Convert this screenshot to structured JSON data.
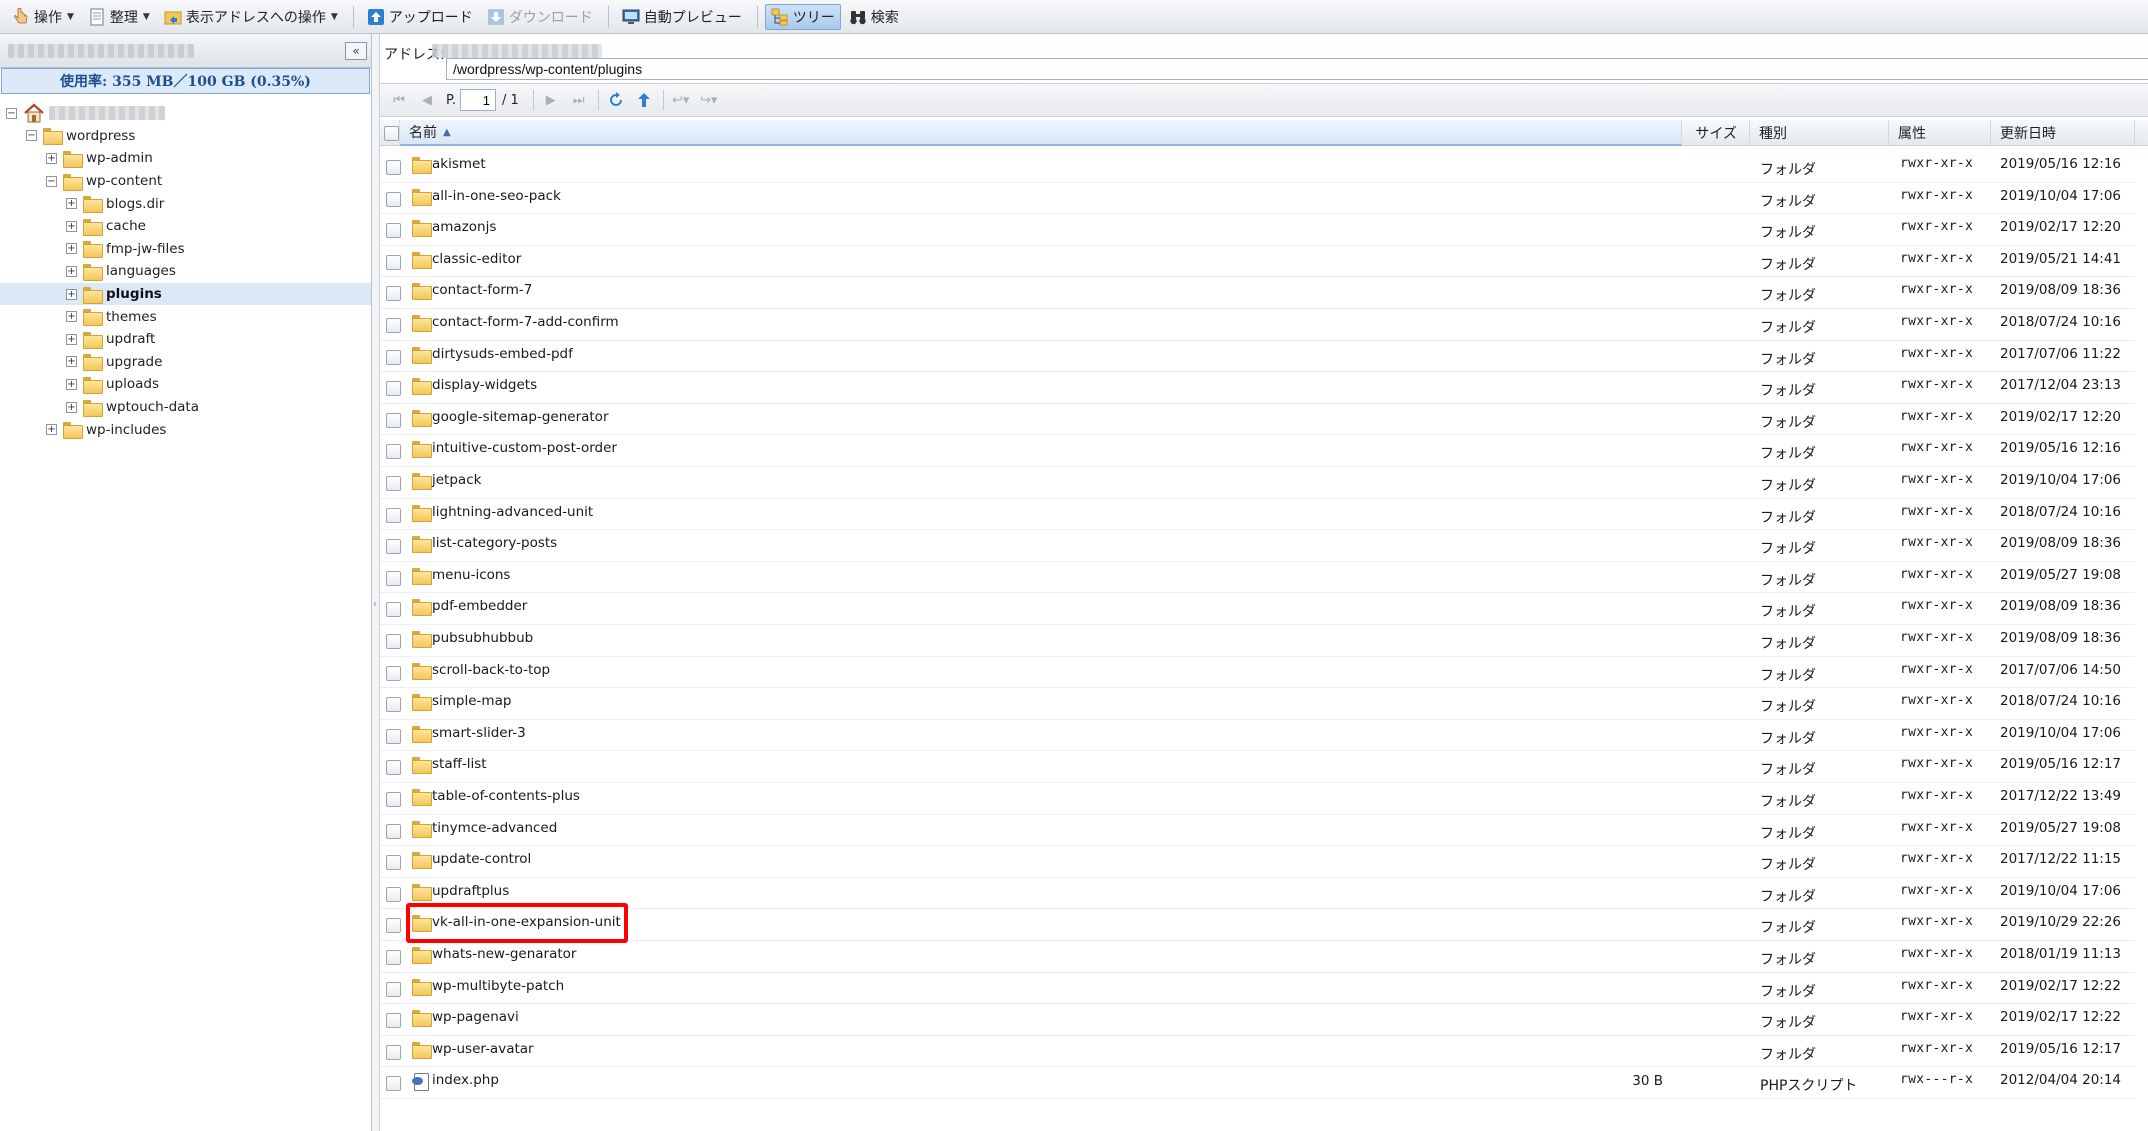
{
  "toolbar": {
    "operation": "操作",
    "organize": "整理",
    "address_ops": "表示アドレスへの操作",
    "upload": "アップロード",
    "download": "ダウンロード",
    "auto_preview": "自動プレビュー",
    "tree": "ツリー",
    "search": "検索"
  },
  "sidebar": {
    "usage": "使用率: 355 MB／100 GB (0.35%)",
    "tree": [
      {
        "label": "",
        "depth": 0,
        "expander": "−",
        "icon": "home-icon"
      },
      {
        "label": "wordpress",
        "depth": 1,
        "expander": "−",
        "icon": "folder-icon"
      },
      {
        "label": "wp-admin",
        "depth": 2,
        "expander": "+",
        "icon": "folder-icon"
      },
      {
        "label": "wp-content",
        "depth": 2,
        "expander": "−",
        "icon": "folder-icon"
      },
      {
        "label": "blogs.dir",
        "depth": 3,
        "expander": "+",
        "icon": "folder-icon"
      },
      {
        "label": "cache",
        "depth": 3,
        "expander": "+",
        "icon": "folder-icon"
      },
      {
        "label": "fmp-jw-files",
        "depth": 3,
        "expander": "+",
        "icon": "folder-icon"
      },
      {
        "label": "languages",
        "depth": 3,
        "expander": "+",
        "icon": "folder-icon"
      },
      {
        "label": "plugins",
        "depth": 3,
        "expander": "+",
        "icon": "folder-icon",
        "selected": true
      },
      {
        "label": "themes",
        "depth": 3,
        "expander": "+",
        "icon": "folder-icon"
      },
      {
        "label": "updraft",
        "depth": 3,
        "expander": "+",
        "icon": "folder-icon"
      },
      {
        "label": "upgrade",
        "depth": 3,
        "expander": "+",
        "icon": "folder-icon"
      },
      {
        "label": "uploads",
        "depth": 3,
        "expander": "+",
        "icon": "folder-icon"
      },
      {
        "label": "wptouch-data",
        "depth": 3,
        "expander": "+",
        "icon": "folder-icon"
      },
      {
        "label": "wp-includes",
        "depth": 2,
        "expander": "+",
        "icon": "folder-icon"
      }
    ]
  },
  "address": {
    "label": "アドレス:",
    "path": "/wordpress/wp-content/plugins"
  },
  "pager": {
    "label": "P.",
    "page": "1",
    "total": "/ 1"
  },
  "columns": {
    "name": "名前",
    "size": "サイズ",
    "kind": "種別",
    "perm": "属性",
    "date": "更新日時"
  },
  "files": [
    {
      "name": "akismet",
      "size": "",
      "kind": "フォルダ",
      "perm": "rwxr-xr-x",
      "date": "2019/05/16 12:16",
      "icon": "folder-icon"
    },
    {
      "name": "all-in-one-seo-pack",
      "size": "",
      "kind": "フォルダ",
      "perm": "rwxr-xr-x",
      "date": "2019/10/04 17:06",
      "icon": "folder-icon"
    },
    {
      "name": "amazonjs",
      "size": "",
      "kind": "フォルダ",
      "perm": "rwxr-xr-x",
      "date": "2019/02/17 12:20",
      "icon": "folder-icon"
    },
    {
      "name": "classic-editor",
      "size": "",
      "kind": "フォルダ",
      "perm": "rwxr-xr-x",
      "date": "2019/05/21 14:41",
      "icon": "folder-icon"
    },
    {
      "name": "contact-form-7",
      "size": "",
      "kind": "フォルダ",
      "perm": "rwxr-xr-x",
      "date": "2019/08/09 18:36",
      "icon": "folder-icon"
    },
    {
      "name": "contact-form-7-add-confirm",
      "size": "",
      "kind": "フォルダ",
      "perm": "rwxr-xr-x",
      "date": "2018/07/24 10:16",
      "icon": "folder-icon"
    },
    {
      "name": "dirtysuds-embed-pdf",
      "size": "",
      "kind": "フォルダ",
      "perm": "rwxr-xr-x",
      "date": "2017/07/06 11:22",
      "icon": "folder-icon"
    },
    {
      "name": "display-widgets",
      "size": "",
      "kind": "フォルダ",
      "perm": "rwxr-xr-x",
      "date": "2017/12/04 23:13",
      "icon": "folder-icon"
    },
    {
      "name": "google-sitemap-generator",
      "size": "",
      "kind": "フォルダ",
      "perm": "rwxr-xr-x",
      "date": "2019/02/17 12:20",
      "icon": "folder-icon"
    },
    {
      "name": "intuitive-custom-post-order",
      "size": "",
      "kind": "フォルダ",
      "perm": "rwxr-xr-x",
      "date": "2019/05/16 12:16",
      "icon": "folder-icon"
    },
    {
      "name": "jetpack",
      "size": "",
      "kind": "フォルダ",
      "perm": "rwxr-xr-x",
      "date": "2019/10/04 17:06",
      "icon": "folder-icon"
    },
    {
      "name": "lightning-advanced-unit",
      "size": "",
      "kind": "フォルダ",
      "perm": "rwxr-xr-x",
      "date": "2018/07/24 10:16",
      "icon": "folder-icon"
    },
    {
      "name": "list-category-posts",
      "size": "",
      "kind": "フォルダ",
      "perm": "rwxr-xr-x",
      "date": "2019/08/09 18:36",
      "icon": "folder-icon"
    },
    {
      "name": "menu-icons",
      "size": "",
      "kind": "フォルダ",
      "perm": "rwxr-xr-x",
      "date": "2019/05/27 19:08",
      "icon": "folder-icon"
    },
    {
      "name": "pdf-embedder",
      "size": "",
      "kind": "フォルダ",
      "perm": "rwxr-xr-x",
      "date": "2019/08/09 18:36",
      "icon": "folder-icon"
    },
    {
      "name": "pubsubhubbub",
      "size": "",
      "kind": "フォルダ",
      "perm": "rwxr-xr-x",
      "date": "2019/08/09 18:36",
      "icon": "folder-icon"
    },
    {
      "name": "scroll-back-to-top",
      "size": "",
      "kind": "フォルダ",
      "perm": "rwxr-xr-x",
      "date": "2017/07/06 14:50",
      "icon": "folder-icon"
    },
    {
      "name": "simple-map",
      "size": "",
      "kind": "フォルダ",
      "perm": "rwxr-xr-x",
      "date": "2018/07/24 10:16",
      "icon": "folder-icon"
    },
    {
      "name": "smart-slider-3",
      "size": "",
      "kind": "フォルダ",
      "perm": "rwxr-xr-x",
      "date": "2019/10/04 17:06",
      "icon": "folder-icon"
    },
    {
      "name": "staff-list",
      "size": "",
      "kind": "フォルダ",
      "perm": "rwxr-xr-x",
      "date": "2019/05/16 12:17",
      "icon": "folder-icon"
    },
    {
      "name": "table-of-contents-plus",
      "size": "",
      "kind": "フォルダ",
      "perm": "rwxr-xr-x",
      "date": "2017/12/22 13:49",
      "icon": "folder-icon"
    },
    {
      "name": "tinymce-advanced",
      "size": "",
      "kind": "フォルダ",
      "perm": "rwxr-xr-x",
      "date": "2019/05/27 19:08",
      "icon": "folder-icon"
    },
    {
      "name": "update-control",
      "size": "",
      "kind": "フォルダ",
      "perm": "rwxr-xr-x",
      "date": "2017/12/22 11:15",
      "icon": "folder-icon"
    },
    {
      "name": "updraftplus",
      "size": "",
      "kind": "フォルダ",
      "perm": "rwxr-xr-x",
      "date": "2019/10/04 17:06",
      "icon": "folder-icon"
    },
    {
      "name": "vk-all-in-one-expansion-unit",
      "size": "",
      "kind": "フォルダ",
      "perm": "rwxr-xr-x",
      "date": "2019/10/29 22:26",
      "icon": "folder-icon",
      "highlighted": true
    },
    {
      "name": "whats-new-genarator",
      "size": "",
      "kind": "フォルダ",
      "perm": "rwxr-xr-x",
      "date": "2018/01/19 11:13",
      "icon": "folder-icon"
    },
    {
      "name": "wp-multibyte-patch",
      "size": "",
      "kind": "フォルダ",
      "perm": "rwxr-xr-x",
      "date": "2019/02/17 12:22",
      "icon": "folder-icon"
    },
    {
      "name": "wp-pagenavi",
      "size": "",
      "kind": "フォルダ",
      "perm": "rwxr-xr-x",
      "date": "2019/02/17 12:22",
      "icon": "folder-icon"
    },
    {
      "name": "wp-user-avatar",
      "size": "",
      "kind": "フォルダ",
      "perm": "rwxr-xr-x",
      "date": "2019/05/16 12:17",
      "icon": "folder-icon"
    },
    {
      "name": "index.php",
      "size": "30 B",
      "kind": "PHPスクリプト",
      "perm": "rwx---r-x",
      "date": "2012/04/04 20:14",
      "icon": "php-file-icon"
    }
  ],
  "colors": {
    "selection": "#dde8f6",
    "highlight_box": "#ff0000",
    "usage_text": "#1d4f8f"
  }
}
